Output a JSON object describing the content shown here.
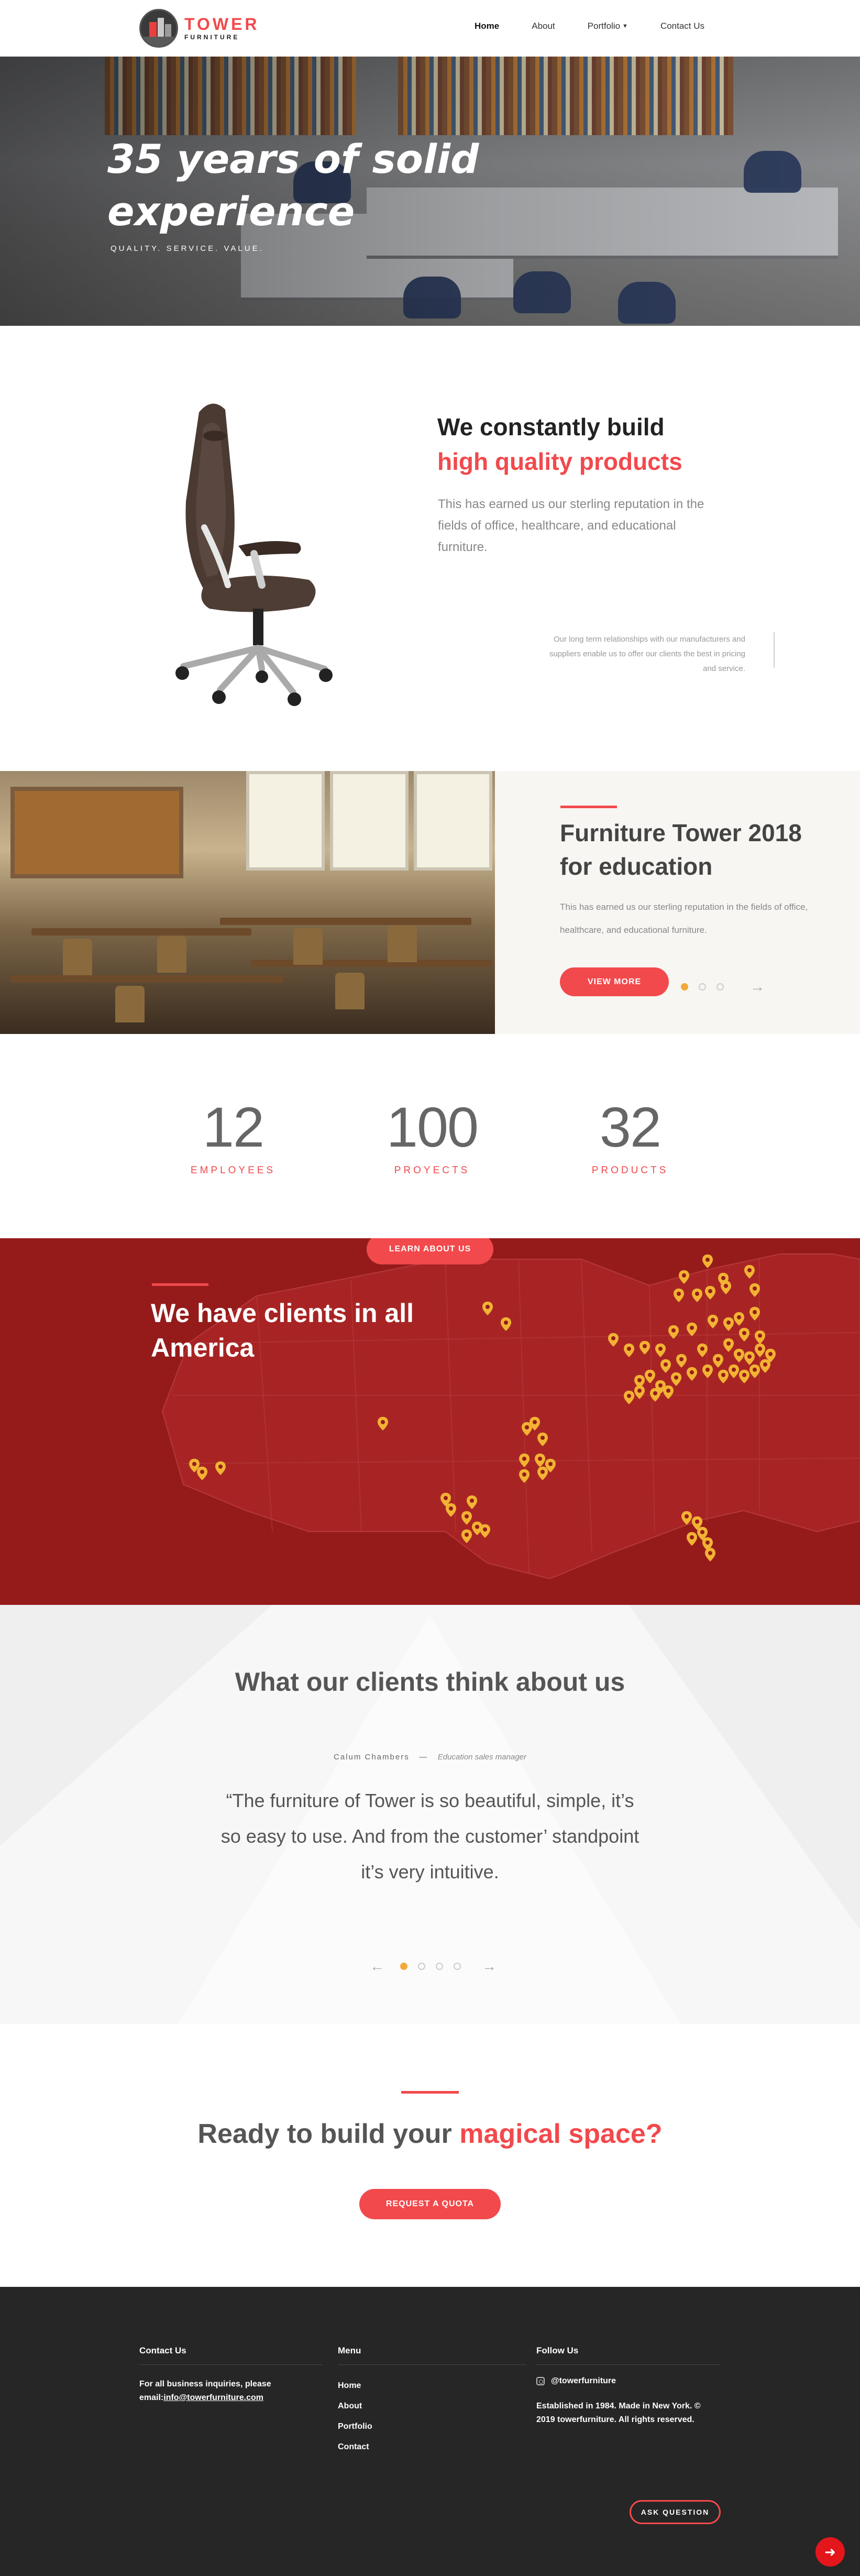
{
  "header": {
    "logo_title": "TOWER",
    "logo_sub": "FURNITURE",
    "nav": [
      {
        "label": "Home"
      },
      {
        "label": "About"
      },
      {
        "label": "Portfolio"
      },
      {
        "label": "Contact Us"
      }
    ]
  },
  "hero": {
    "title": "35 years of solid experience",
    "subtitle": "QUALITY. SERVICE. VALUE."
  },
  "quality": {
    "heading_line1": "We constantly build",
    "heading_line2": "high quality products",
    "description": "This has earned us our sterling reputation in the fields of office, healthcare, and educational furniture.",
    "note": "Our long term relationships with our manufacturers and suppliers enable us to offer our clients the best in pricing and service."
  },
  "education": {
    "title": "Furniture Tower 2018 for education",
    "description": "This has earned us our sterling reputation in the fields of office, healthcare, and educational furniture.",
    "button": "VIEW MORE"
  },
  "stats": [
    {
      "value": "12",
      "label": "EMPLOYEES"
    },
    {
      "value": "100",
      "label": "PROYECTS"
    },
    {
      "value": "32",
      "label": "PRODUCTS"
    }
  ],
  "map": {
    "button": "LEARN ABOUT US",
    "title": "We have clients in all America"
  },
  "testimonial": {
    "title": "What our clients think about us",
    "author": "Calum Chambers",
    "separator": "—",
    "role": "Education sales manager",
    "quote": "“The furniture of Tower is so beautiful, simple, it’s so easy to use. And from the customer’ standpoint it’s very intuitive."
  },
  "cta": {
    "title_plain": "Ready to build your",
    "title_accent": "magical space?",
    "button": "REQUEST A QUOTA"
  },
  "footer": {
    "contact_head": "Contact Us",
    "contact_text": "For all business inquiries, please email:",
    "contact_email": "info@towerfurniture.com",
    "menu_head": "Menu",
    "menu": [
      "Home",
      "About",
      "Portfolio",
      "Contact"
    ],
    "follow_head": "Follow Us",
    "instagram": "@towerfurniture",
    "established": "Established in 1984. Made in New York. © 2019 towerfurniture. All rights reserved.",
    "ask_button": "ASK QUESTION"
  },
  "colors": {
    "accent": "#f2494c",
    "map_bg": "#951b1b",
    "pin": "#f2b233",
    "footer_bg": "#262626"
  }
}
